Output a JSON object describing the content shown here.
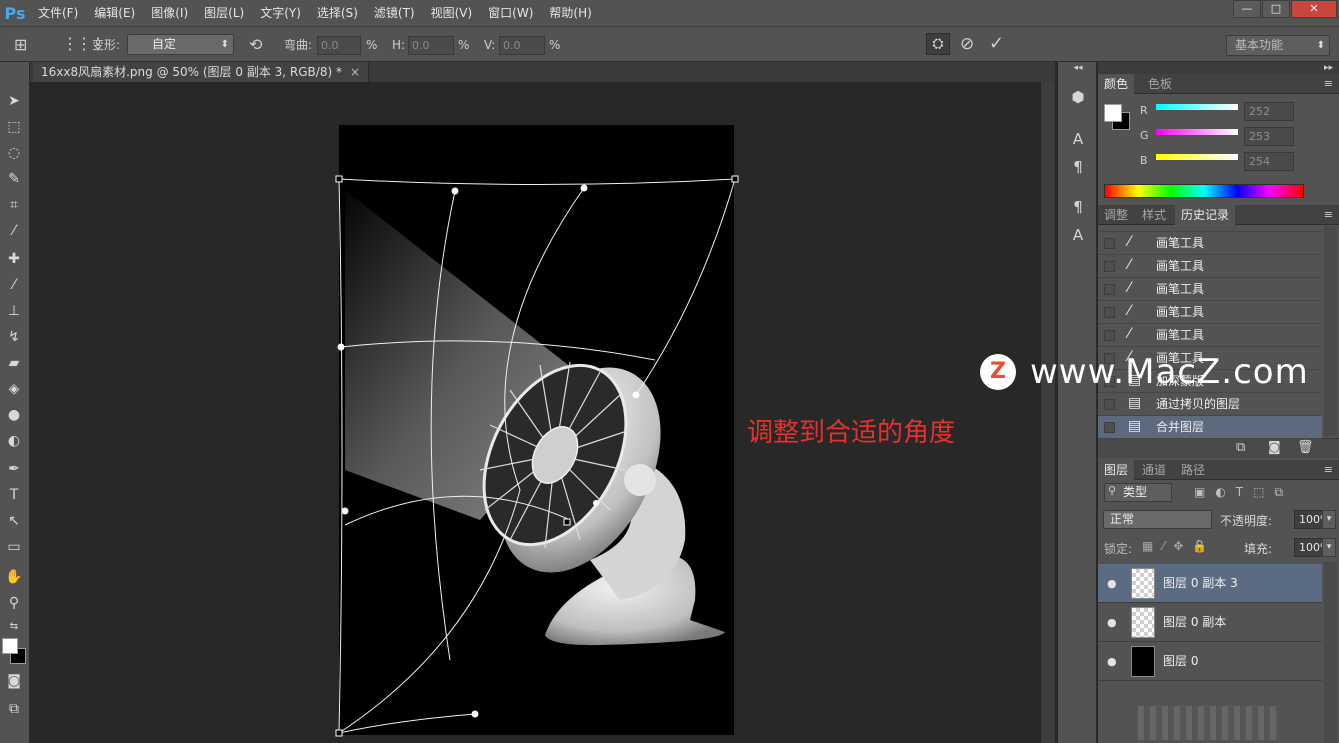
{
  "app": {
    "logo": "Ps"
  },
  "menu": [
    "文件(F)",
    "编辑(E)",
    "图像(I)",
    "图层(L)",
    "文字(Y)",
    "选择(S)",
    "滤镜(T)",
    "视图(V)",
    "窗口(W)",
    "帮助(H)"
  ],
  "window_controls": {
    "minimize": "—",
    "maximize": "□",
    "close": "✕"
  },
  "options": {
    "warp_label": "变形:",
    "warp_value": "自定",
    "bend_label": "弯曲:",
    "bend_value": "0.0",
    "pct1": "%",
    "h_label": "H:",
    "h_value": "0.0",
    "pct2": "%",
    "v_label": "V:",
    "v_value": "0.0",
    "pct3": "%",
    "workspace": "基本功能"
  },
  "document": {
    "tab_title": "16xx8风扇素材.png @ 50% (图层 0 副本 3, RGB/8) *",
    "close": "×"
  },
  "annotation": "调整到合适的角度",
  "color_panel": {
    "tabs": [
      "颜色",
      "色板"
    ],
    "r_label": "R",
    "r_value": "252",
    "g_label": "G",
    "g_value": "253",
    "b_label": "B",
    "b_value": "254",
    "colors": {
      "fg": "#ffffff",
      "bg": "#000000"
    }
  },
  "history_panel": {
    "tabs": [
      "调整",
      "样式",
      "历史记录"
    ],
    "items": [
      {
        "label": "画笔工具",
        "icon": "brush-icon"
      },
      {
        "label": "画笔工具",
        "icon": "brush-icon"
      },
      {
        "label": "画笔工具",
        "icon": "brush-icon"
      },
      {
        "label": "画笔工具",
        "icon": "brush-icon"
      },
      {
        "label": "画笔工具",
        "icon": "brush-icon"
      },
      {
        "label": "画笔工具",
        "icon": "brush-icon"
      },
      {
        "label": "加深蒙版",
        "icon": "document-icon"
      },
      {
        "label": "通过拷贝的图层",
        "icon": "document-icon"
      },
      {
        "label": "合并图层",
        "icon": "document-icon"
      }
    ]
  },
  "layers_panel": {
    "tabs": [
      "图层",
      "通道",
      "路径"
    ],
    "filter": "类型",
    "blend_mode": "正常",
    "opacity_label": "不透明度:",
    "opacity_value": "100%",
    "lock_label": "锁定:",
    "fill_label": "填充:",
    "fill_value": "100%",
    "layers": [
      {
        "name": "图层 0 副本 3",
        "selected": true
      },
      {
        "name": "图层 0 副本",
        "selected": false
      },
      {
        "name": "图层 0",
        "selected": false
      }
    ]
  },
  "watermark": {
    "logo": "Z",
    "text": "www.MacZ.com"
  }
}
